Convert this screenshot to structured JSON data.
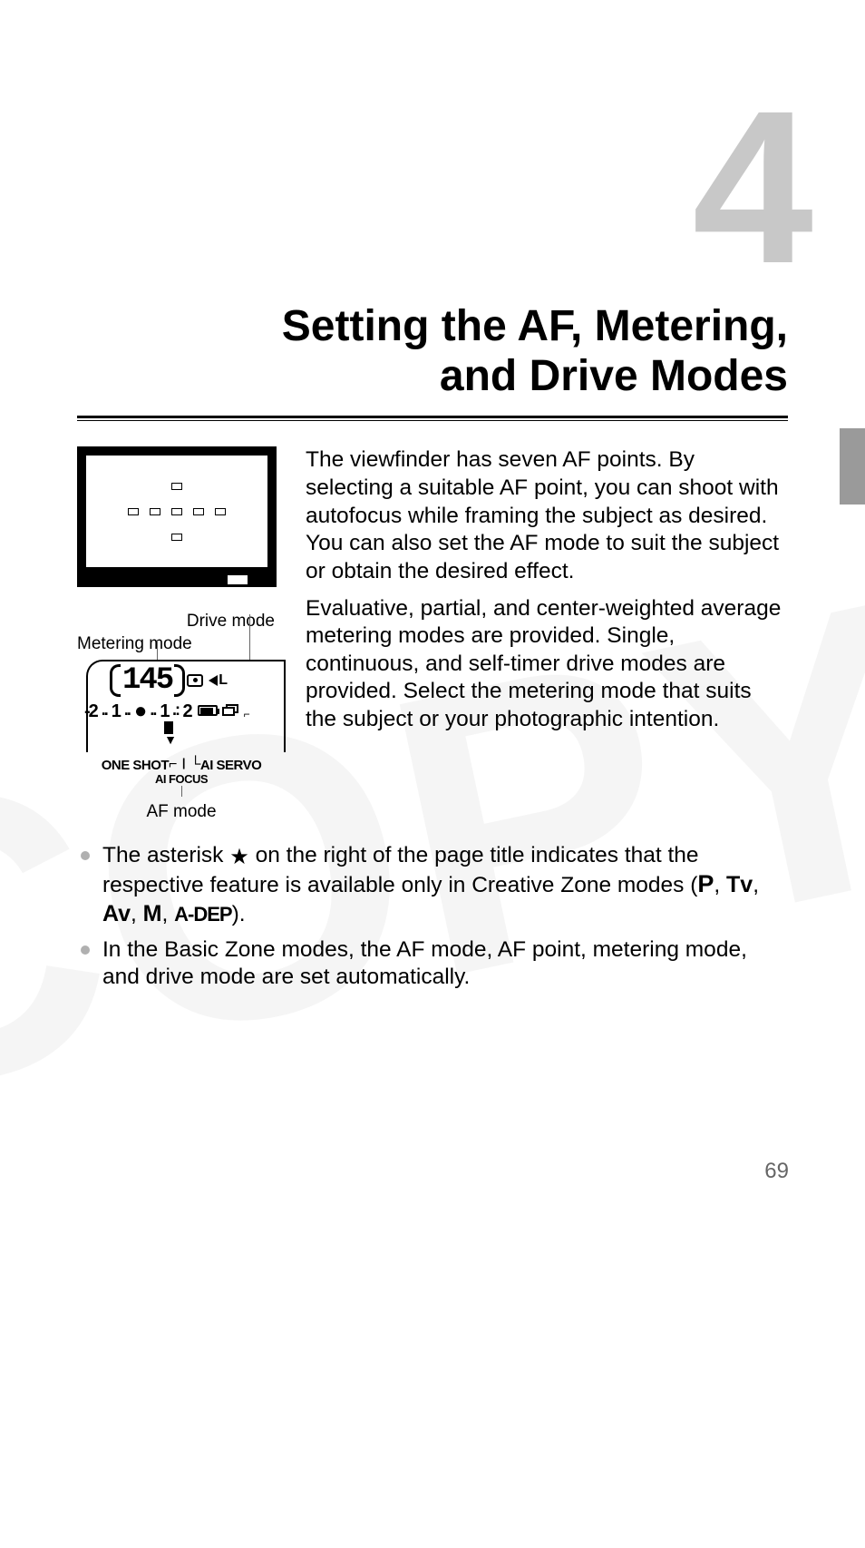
{
  "chapter_number": "4",
  "title_line1": "Setting the AF, Metering,",
  "title_line2": "and Drive Modes",
  "labels": {
    "drive": "Drive mode",
    "metering": "Metering mode",
    "af_mode": "AF mode"
  },
  "lcd": {
    "shots": "145",
    "quality_letter": "L",
    "exposure_scale": "-2..1....1.:2",
    "af_one_shot": "ONE SHOT",
    "af_ai_servo": "AI SERVO",
    "af_ai_focus": "AI FOCUS"
  },
  "paragraph1": "The viewfinder has seven AF points. By selecting a suitable AF point, you can shoot with autofocus while framing the subject as desired. You can also set the AF mode to suit the subject or obtain the desired effect.",
  "paragraph2": "Evaluative, partial, and center-weighted average metering modes are provided. Single, continuous, and self-timer drive modes are provided. Select the metering mode that suits the subject or your photographic intention.",
  "bullet1_pre": "The asterisk ",
  "bullet1_post": " on the right of the page title indicates that the respective feature is available only in Creative Zone modes (",
  "bullet1_end": ").",
  "modes": {
    "p": "P",
    "tv": "Tv",
    "av": "Av",
    "m": "M",
    "adep": "A-DEP"
  },
  "bullet2": "In the Basic Zone modes, the AF mode, AF point, metering mode, and drive mode are set automatically.",
  "page_number": "69"
}
